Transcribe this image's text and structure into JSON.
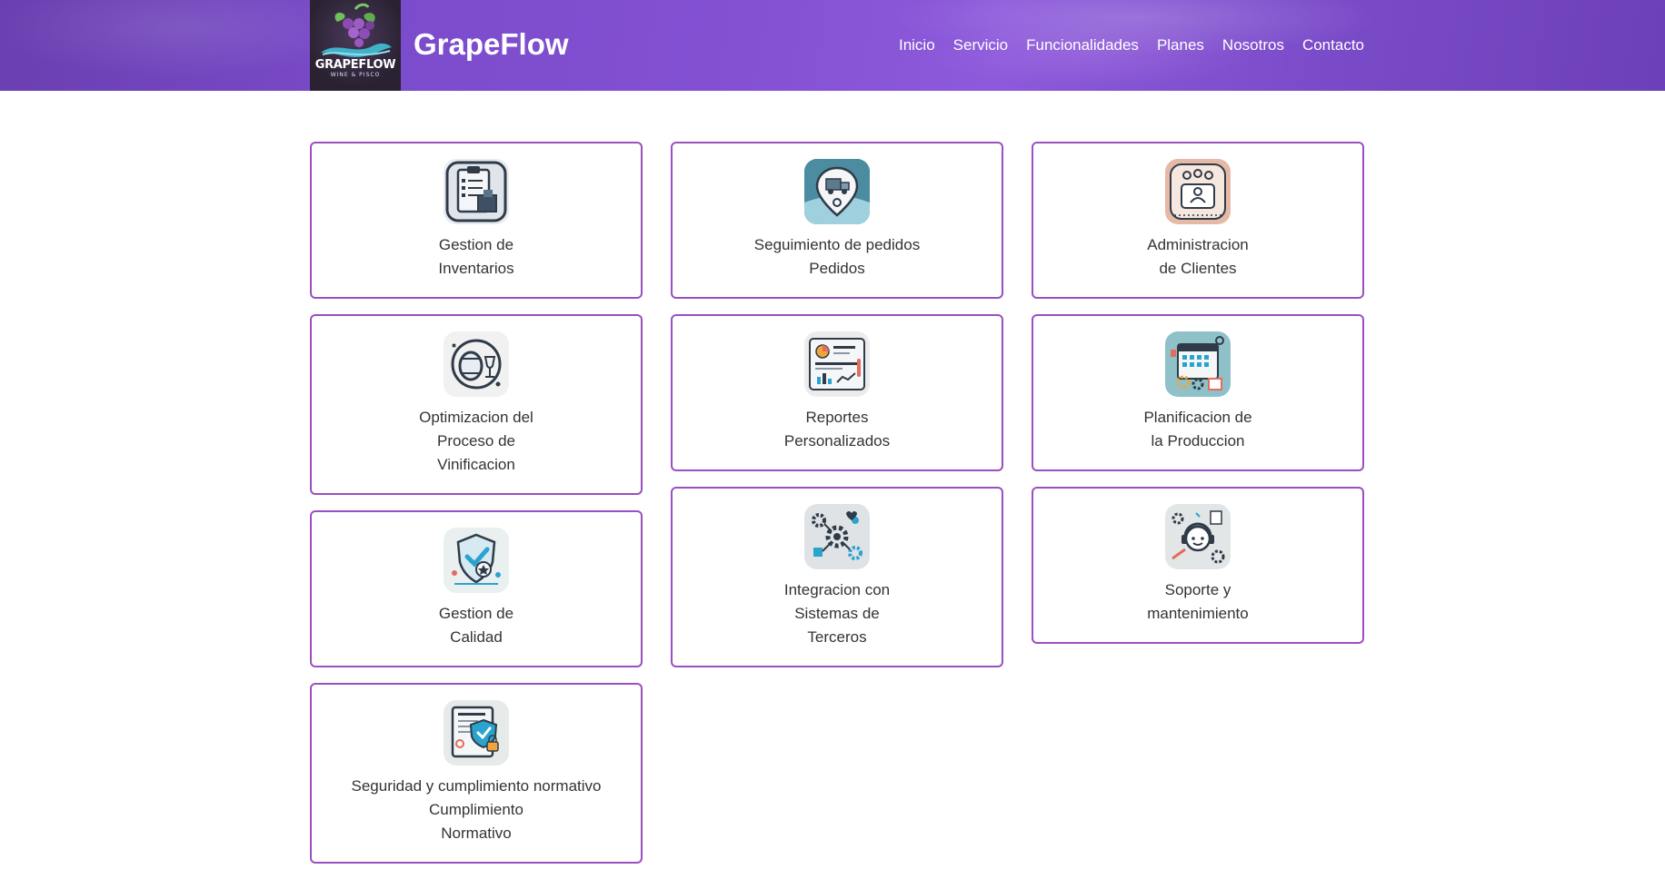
{
  "brand": {
    "logo_text": "GRAPEFLOW",
    "logo_subtitle": "WINE & PISCO",
    "name": "GrapeFlow"
  },
  "nav": {
    "items": [
      "Inicio",
      "Servicio",
      "Funcionalidades",
      "Planes",
      "Nosotros",
      "Contacto"
    ]
  },
  "cards": [
    {
      "title": "Gestion de\nInventarios",
      "icon": "inventory-clipboard-icon"
    },
    {
      "title": "Seguimiento de pedidos\nPedidos",
      "icon": "order-tracking-truck-icon"
    },
    {
      "title": "Administracion\nde Clientes",
      "icon": "client-management-icon"
    },
    {
      "title": "Optimizacion del\nProceso de\nVinificacion",
      "icon": "wine-barrel-icon"
    },
    {
      "title": "Reportes\nPersonalizados",
      "icon": "reports-dashboard-icon"
    },
    {
      "title": "Planificacion de\nla Produccion",
      "icon": "production-calendar-icon"
    },
    {
      "title": "Gestion de\nCalidad",
      "icon": "quality-shield-icon"
    },
    {
      "title": "Integracion con\nSistemas de\nTerceros",
      "icon": "integration-gears-icon"
    },
    {
      "title": "Soporte y\nmantenimiento",
      "icon": "support-headset-icon"
    },
    {
      "title": "Seguridad y cumplimiento normativo\nCumplimiento\nNormativo",
      "icon": "security-compliance-icon"
    }
  ],
  "colors": {
    "header_purple": "#7b4ccc",
    "card_border": "#9b4fc0",
    "text": "#333333"
  }
}
